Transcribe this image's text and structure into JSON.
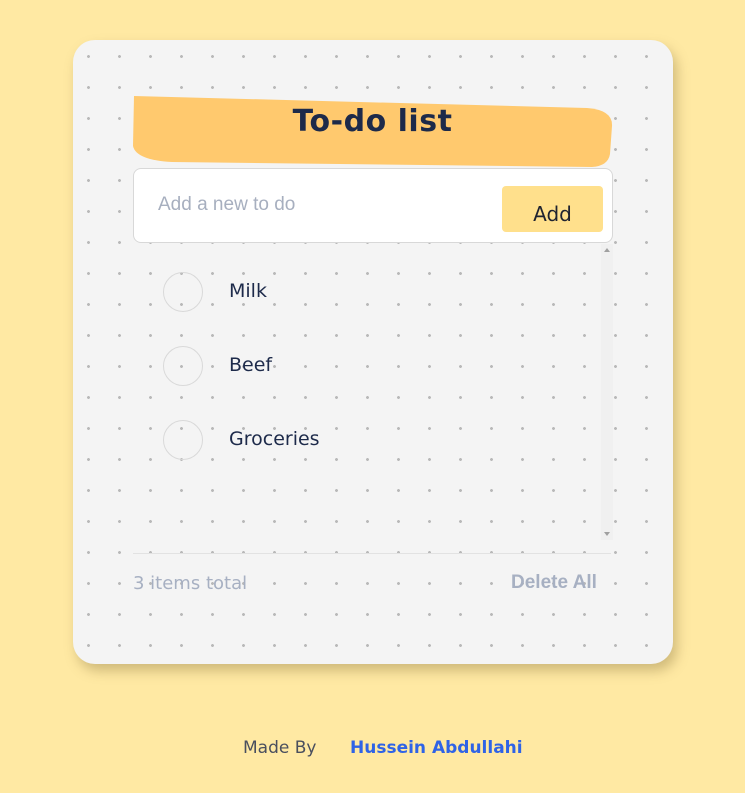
{
  "app": {
    "title": "To-do list"
  },
  "input": {
    "placeholder": "Add a new to do",
    "value": "",
    "add_label": "Add"
  },
  "todos": [
    {
      "label": "Milk",
      "done": false
    },
    {
      "label": "Beef",
      "done": false
    },
    {
      "label": "Groceries",
      "done": false
    }
  ],
  "footer_bar": {
    "items_total": "3 items total",
    "delete_all_label": "Delete All"
  },
  "credits": {
    "made_by_label": "Made By",
    "author_name": "Hussein Abdullahi"
  },
  "colors": {
    "page_background": "#ffe9a3",
    "banner": "#ffc96e",
    "add_button": "#ffe08c",
    "text_dark": "#1d2a4a",
    "muted": "#a7b0c2",
    "link": "#2f63e6"
  },
  "icons": {
    "todo_check": "circle-outline-icon",
    "scroll_up": "scroll-up-arrow-icon",
    "scroll_down": "scroll-down-arrow-icon"
  }
}
